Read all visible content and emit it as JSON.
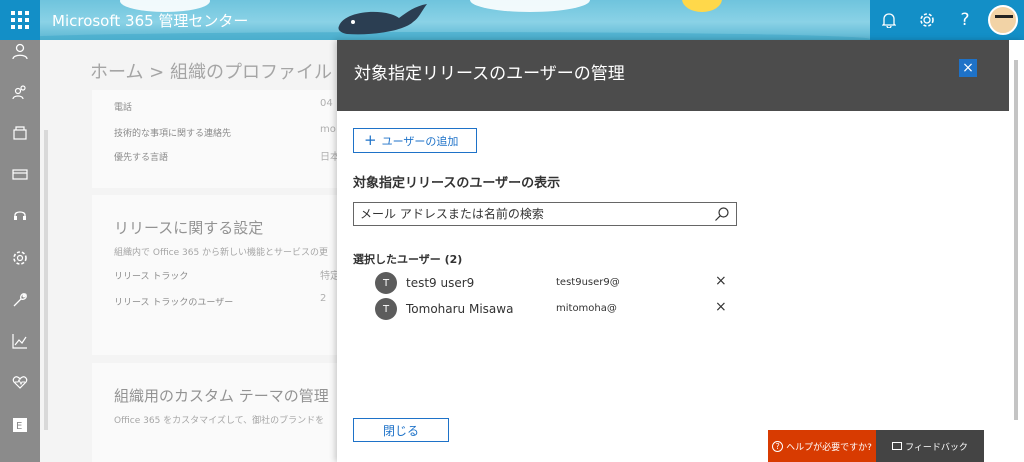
{
  "header": {
    "app_title": "Microsoft 365 管理センター",
    "icons": [
      "notification-bell-icon",
      "settings-gear-icon",
      "help-question-icon"
    ],
    "brand_color": "#138fc7"
  },
  "leftnav": {
    "icons": [
      "user-icon",
      "group-icon",
      "resources-icon",
      "billing-icon",
      "support-icon",
      "settings-icon",
      "setup-wrench-icon",
      "reports-chart-icon",
      "health-heart-icon",
      "exchange-icon"
    ]
  },
  "background_page": {
    "breadcrumb": "ホーム > 組織のプロファイル",
    "contact_rows": [
      {
        "label": "電話",
        "value": "04"
      },
      {
        "label": "技術的な事項に関する連絡先",
        "value": "mo"
      },
      {
        "label": "優先する言語",
        "value": "日本"
      }
    ],
    "release_card": {
      "title": "リリースに関する設定",
      "subtitle": "組織内で Office 365 から新しい機能とサービスの更",
      "rows": [
        {
          "label": "リリース トラック",
          "value": "特定"
        },
        {
          "label": "リリース トラックのユーザー",
          "value": "2"
        }
      ]
    },
    "theme_card": {
      "title": "組織用のカスタム テーマの管理",
      "subtitle": "Office 365 をカスタマイズして、御社のブランドを"
    }
  },
  "panel": {
    "title": "対象指定リリースのユーザーの管理",
    "close_icon": "×",
    "add_button_label": "ユーザーの追加",
    "view_title": "対象指定リリースのユーザーの表示",
    "search_placeholder": "メール アドレスまたは名前の検索",
    "selected_title": "選択したユーザー (2)",
    "users": [
      {
        "initial": "T",
        "name": "test9 user9",
        "email": "test9user9@"
      },
      {
        "initial": "T",
        "name": "Tomoharu Misawa",
        "email": "mitomoha@"
      }
    ],
    "remove_glyph": "×",
    "close_button_label": "閉じる"
  },
  "footer": {
    "help_label": "ヘルプが必要ですか?",
    "feedback_label": "フィードバック",
    "help_color": "#d83b01"
  }
}
